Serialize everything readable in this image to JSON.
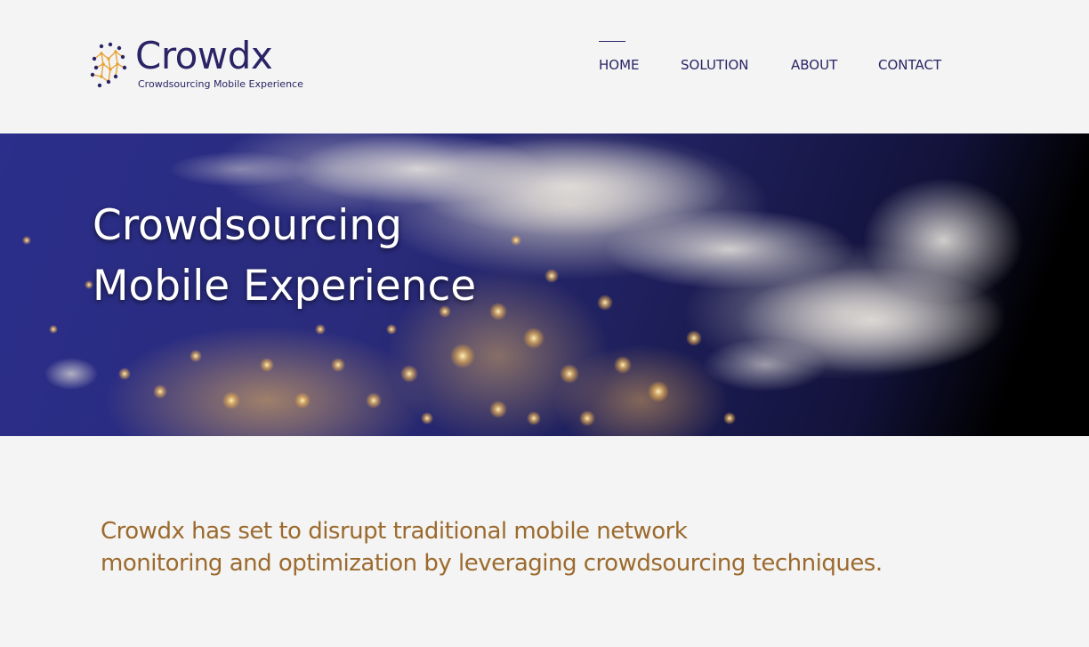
{
  "brand": {
    "name": "Crowdx",
    "tagline": "Crowdsourcing Mobile Experience",
    "colors": {
      "primary": "#2a2466",
      "accent": "#e8a33a",
      "mission_text": "#9c6a2e",
      "background": "#f3f4f3"
    },
    "logo_icon": "network-nodes-icon"
  },
  "nav": {
    "items": [
      {
        "label": "HOME",
        "active": true
      },
      {
        "label": "SOLUTION",
        "active": false
      },
      {
        "label": "ABOUT",
        "active": false
      },
      {
        "label": "CONTACT",
        "active": false
      }
    ]
  },
  "hero": {
    "title_line1": "Crowdsourcing",
    "title_line2": "Mobile Experience",
    "background_image": "earth-at-night-image"
  },
  "mission": {
    "line1": "Crowdx has set to disrupt traditional mobile network",
    "line2": "monitoring and optimization by leveraging crowdsourcing techniques."
  }
}
